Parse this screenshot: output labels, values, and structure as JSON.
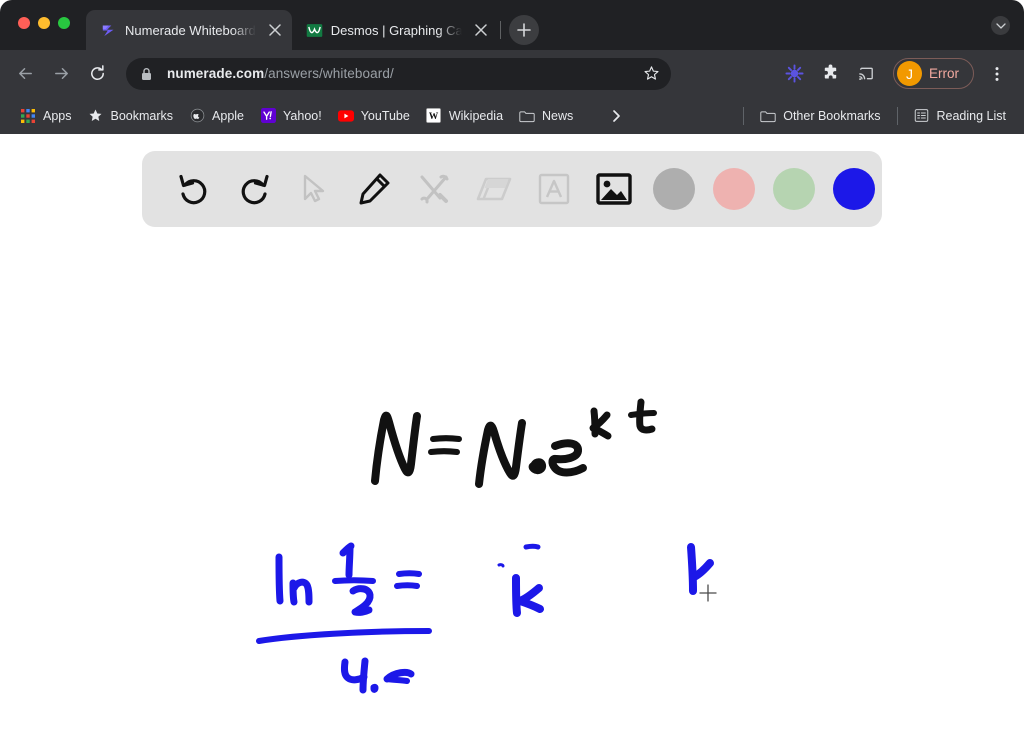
{
  "window": {
    "traffic_lights": [
      "close",
      "minimize",
      "zoom"
    ]
  },
  "tabs": [
    {
      "title": "Numerade Whiteboard",
      "favicon": "numerade-logo-icon",
      "active": true,
      "close_label": "×"
    },
    {
      "title": "Desmos | Graphing Calculator",
      "favicon": "desmos-logo-icon",
      "active": false,
      "close_label": "×"
    }
  ],
  "tabstrip": {
    "new_tab_label": "+",
    "tab_search_label": "▾"
  },
  "toolbar": {
    "back_label": "←",
    "forward_label": "→",
    "reload_label": "↻",
    "lock_icon": "lock-icon",
    "url_host": "numerade.com",
    "url_path": "/answers/whiteboard/",
    "url_full": "numerade.com/answers/whiteboard/",
    "star_icon": "star-outline-icon",
    "sync_icon": "sunburst-icon",
    "extensions_icon": "puzzle-piece-icon",
    "cast_icon": "cast-icon",
    "profile_initial": "J",
    "profile_status": "Error",
    "menu_icon": "three-dots-vertical-icon"
  },
  "bookmarks": {
    "items": [
      {
        "label": "Apps",
        "icon": "apps-grid-icon"
      },
      {
        "label": "Bookmarks",
        "icon": "star-filled-icon"
      },
      {
        "label": "Apple",
        "icon": "apple-icon"
      },
      {
        "label": "Yahoo!",
        "icon": "yahoo-icon"
      },
      {
        "label": "YouTube",
        "icon": "youtube-icon"
      },
      {
        "label": "Wikipedia",
        "icon": "wikipedia-icon"
      },
      {
        "label": "News",
        "icon": "folder-icon"
      }
    ],
    "overflow_label": "›",
    "right_items": [
      {
        "label": "Other Bookmarks",
        "icon": "folder-icon"
      },
      {
        "label": "Reading List",
        "icon": "reading-list-icon"
      }
    ]
  },
  "whiteboard": {
    "tools": [
      {
        "name": "undo",
        "icon": "undo-icon",
        "state": "enabled"
      },
      {
        "name": "redo",
        "icon": "redo-icon",
        "state": "enabled"
      },
      {
        "name": "select",
        "icon": "cursor-arrow-icon",
        "state": "disabled"
      },
      {
        "name": "pen",
        "icon": "pencil-icon",
        "state": "active"
      },
      {
        "name": "shapes",
        "icon": "tools-cross-icon",
        "state": "disabled"
      },
      {
        "name": "eraser",
        "icon": "eraser-icon",
        "state": "disabled"
      },
      {
        "name": "text",
        "icon": "text-box-icon",
        "state": "disabled"
      },
      {
        "name": "image",
        "icon": "image-icon",
        "state": "enabled"
      }
    ],
    "colors": [
      {
        "name": "gray",
        "hex": "#aeaeae",
        "selected": false
      },
      {
        "name": "pink",
        "hex": "#eeb2b0",
        "selected": false
      },
      {
        "name": "green",
        "hex": "#b6d4b1",
        "selected": false
      },
      {
        "name": "blue",
        "hex": "#1c18e8",
        "selected": true
      }
    ],
    "ink": {
      "equation_black": "N = N₀ e^{kt}",
      "equation_blue_numerator": "ln 1/2 =",
      "equation_blue_denominator": "4.5",
      "loose_letter_k": "k",
      "loose_stroke": "k",
      "black_hex": "#111111",
      "blue_hex": "#1c18e8"
    },
    "cursor": "crosshair-cursor"
  }
}
